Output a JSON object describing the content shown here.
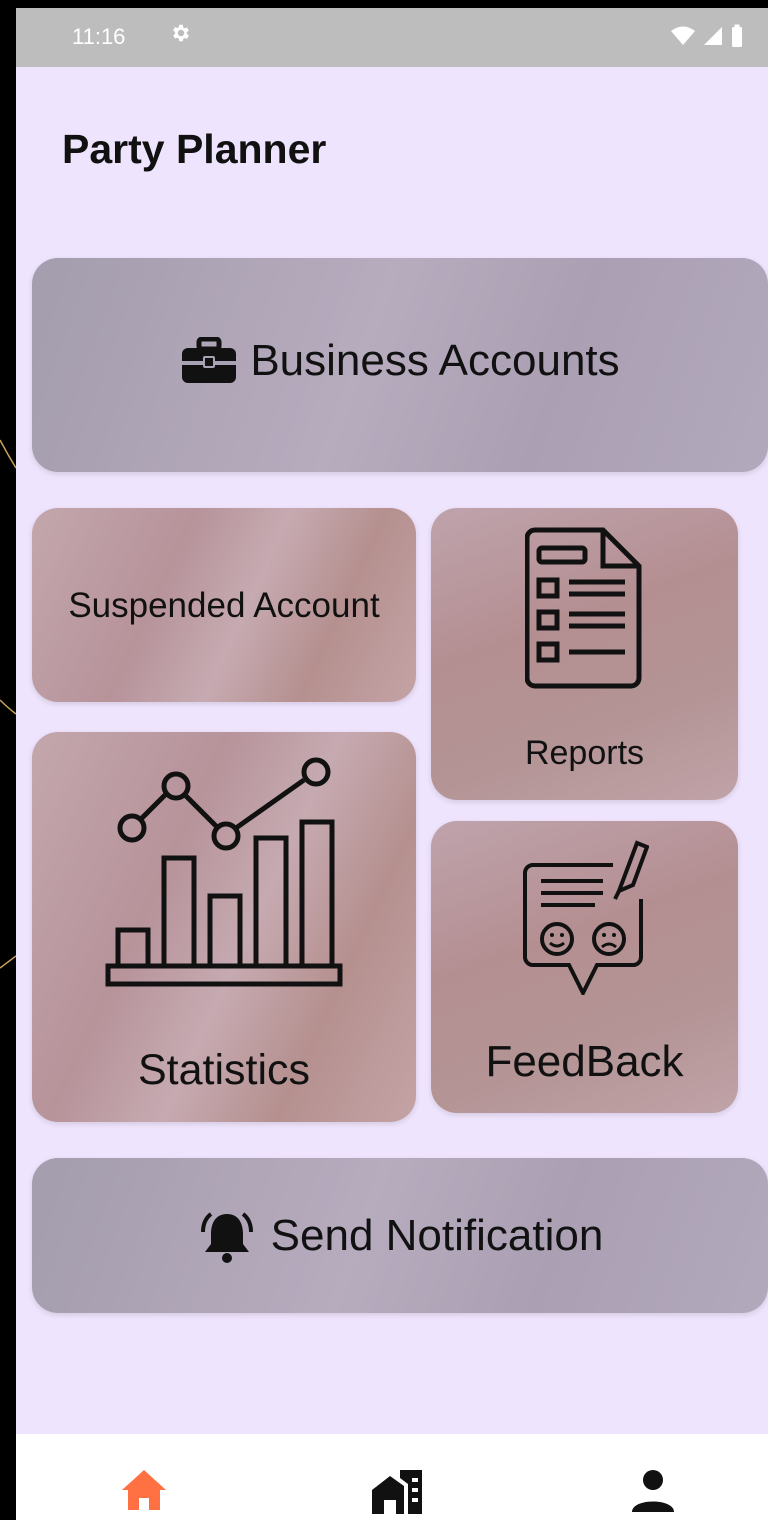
{
  "status_bar": {
    "time": "11:16"
  },
  "app": {
    "title": "Party Planner"
  },
  "cards": {
    "business_accounts": "Business Accounts",
    "suspended_account": "Suspended Account",
    "reports": "Reports",
    "statistics": "Statistics",
    "feedback": "FeedBack",
    "send_notification": "Send Notification"
  },
  "bottom_nav": {
    "items": [
      {
        "name": "home",
        "icon": "home-icon",
        "active": true,
        "color": "#ff7043"
      },
      {
        "name": "venues",
        "icon": "building-icon",
        "active": false,
        "color": "#111111"
      },
      {
        "name": "profile",
        "icon": "person-icon",
        "active": false,
        "color": "#111111"
      }
    ]
  },
  "colors": {
    "background": "#efe4fd",
    "status_bar": "#bdbdbd",
    "accent": "#ff7043"
  }
}
